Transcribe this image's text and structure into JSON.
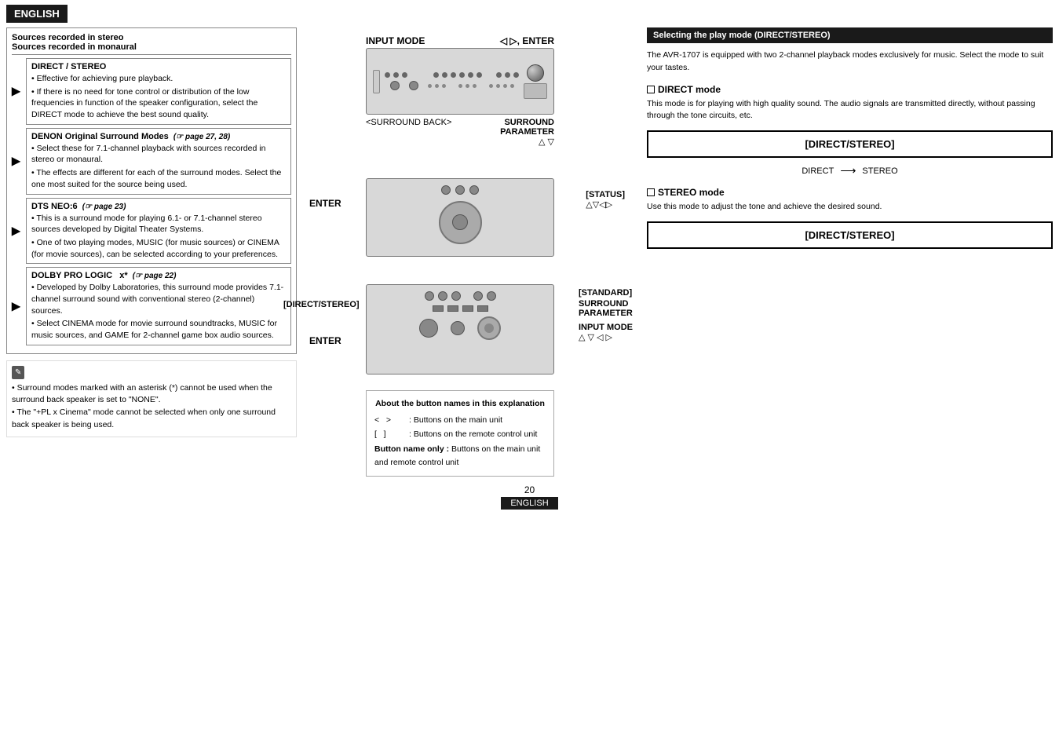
{
  "header": {
    "lang": "ENGLISH"
  },
  "left_col": {
    "sources_title": "Sources recorded in stereo\nSources recorded in monaural",
    "blocks": [
      {
        "title": "DIRECT / STEREO",
        "page": "",
        "bullets": [
          "Effective for achieving pure playback.",
          "If there is no need for tone control or distribution of the low frequencies in function of the speaker configuration, select the DIRECT mode to achieve the best sound quality."
        ]
      },
      {
        "title": "DENON Original Surround Modes",
        "page": "(☞ page 27, 28)",
        "bullets": [
          "Select these for 7.1-channel playback with sources recorded in stereo or monaural.",
          "The effects are different for each of the surround modes. Select the one most suited for the source being used."
        ]
      },
      {
        "title": "DTS NEO:6",
        "page": "(☞ page 23)",
        "bullets": [
          "This is a surround mode for playing 6.1- or 7.1-channel stereo sources developed by Digital Theater Systems.",
          "One of two playing modes, MUSIC (for music sources) or CINEMA (for movie sources), can be selected according to your preferences."
        ]
      },
      {
        "title": "DOLBY PRO LOGIC  x*",
        "page": "(☞ page 22)",
        "bullets": [
          "Developed by Dolby Laboratories, this surround mode provides 7.1-channel surround sound with conventional stereo (2-channel) sources.",
          "Select CINEMA mode for movie surround soundtracks, MUSIC for music sources, and GAME for 2-channel game box audio sources."
        ]
      }
    ],
    "notes": [
      "Surround modes marked with an asterisk (*) cannot be used when the surround back speaker is set to \"NONE\".",
      "The \"+PL x Cinema\" mode cannot be selected when only one surround back speaker is being used."
    ]
  },
  "mid_col": {
    "device1_labels": {
      "top_left": "INPUT MODE",
      "top_right": "◁ ▷, ENTER",
      "bottom_left": "<SURROUND BACK>",
      "bottom_right_line1": "SURROUND",
      "bottom_right_line2": "PARAMETER",
      "bottom_right_arrows": "△ ▽"
    },
    "device2_labels": {
      "left": "ENTER",
      "right_line1": "[STATUS]",
      "right_line2": "△▽◁▷"
    },
    "device3_labels": {
      "left_top": "[DIRECT/STEREO]",
      "left_bottom": "ENTER",
      "right_line1": "[STANDARD]",
      "right_line2": "SURROUND",
      "right_line3": "PARAMETER",
      "right_line4": "INPUT MODE",
      "right_arrows": "△ ▽ ◁ ▷"
    },
    "btn_names_box": {
      "title": "About the button names in this explanation",
      "rows": [
        {
          "symbol": "< >",
          "desc": ": Buttons on the main unit"
        },
        {
          "symbol": "[ ]",
          "desc": ": Buttons on the remote control unit"
        }
      ],
      "bold_row_label": "Button name only :",
      "bold_row_desc": "Buttons on the main unit and remote control unit"
    }
  },
  "right_col": {
    "section_title": "Selecting the play mode (DIRECT/STEREO)",
    "intro": "The AVR-1707 is equipped with two 2-channel playback modes exclusively for music. Select the mode to suit your tastes.",
    "direct_mode_title": "DIRECT mode",
    "direct_mode_desc": "This mode is for playing with high quality sound. The audio signals are transmitted directly, without passing through the tone circuits, etc.",
    "direct_box_label": "[DIRECT/STEREO]",
    "direct_arrow_from": "DIRECT",
    "direct_arrow_to": "STEREO",
    "stereo_mode_title": "STEREO mode",
    "stereo_mode_desc": "Use this mode to adjust the tone and achieve the desired sound.",
    "stereo_box_label": "[DIRECT/STEREO]"
  },
  "footer": {
    "page_num": "20",
    "lang": "ENGLISH"
  }
}
